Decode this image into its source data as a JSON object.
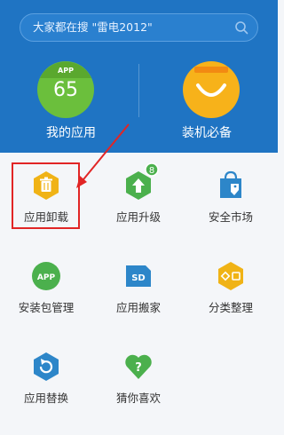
{
  "search": {
    "placeholder_text": "大家都在搜 \"雷电2012\""
  },
  "hero": {
    "my_apps": {
      "badge": "APP",
      "count": "65",
      "label": "我的应用"
    },
    "essentials": {
      "label": "装机必备"
    }
  },
  "grid": {
    "items": [
      {
        "label": "应用卸载",
        "icon": "trash-icon",
        "color": "#f0b316"
      },
      {
        "label": "应用升级",
        "icon": "upgrade-icon",
        "color": "#4bb04d",
        "badge": "8"
      },
      {
        "label": "安全市场",
        "icon": "shopping-bag-icon",
        "color": "#2d86c9"
      },
      {
        "label": "安装包管理",
        "icon": "app-package-icon",
        "color": "#4bb04d",
        "text": "APP"
      },
      {
        "label": "应用搬家",
        "icon": "sd-card-icon",
        "color": "#2d86c9",
        "text": "SD"
      },
      {
        "label": "分类整理",
        "icon": "category-icon",
        "color": "#f0b316"
      },
      {
        "label": "应用替换",
        "icon": "replace-icon",
        "color": "#2d86c9"
      },
      {
        "label": "猜你喜欢",
        "icon": "heart-question-icon",
        "color": "#4bb04d",
        "text": "?"
      }
    ]
  },
  "colors": {
    "header": "#1f74c3",
    "accent_red": "#e12525"
  }
}
